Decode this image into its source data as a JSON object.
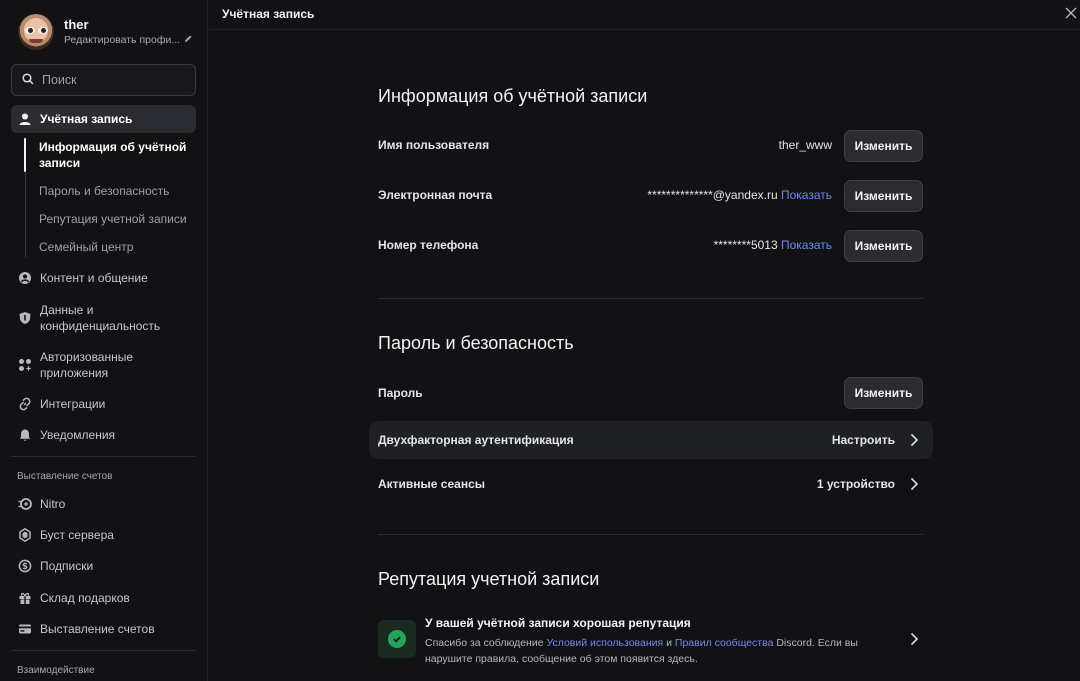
{
  "colors": {
    "background": "#121214",
    "accent_link": "#6d8cf2",
    "success": "#23a55a"
  },
  "profile": {
    "username": "ther",
    "edit_label": "Редактировать профи..."
  },
  "search": {
    "placeholder": "Поиск"
  },
  "sidebar": {
    "items": [
      {
        "label": "Учётная запись",
        "icon": "person-icon",
        "active": true
      },
      {
        "label": "Контент и общение",
        "icon": "emoji-icon"
      },
      {
        "label": "Данные и конфиденциальность",
        "icon": "shield-icon"
      },
      {
        "label": "Авторизованные приложения",
        "icon": "apps-icon"
      },
      {
        "label": "Интеграции",
        "icon": "link-icon"
      },
      {
        "label": "Уведомления",
        "icon": "bell-icon"
      }
    ],
    "subitems": [
      {
        "label": "Информация об учётной записи",
        "active": true
      },
      {
        "label": "Пароль и безопасность"
      },
      {
        "label": "Репутация учетной записи"
      },
      {
        "label": "Семейный центр"
      }
    ],
    "billing_header": "Выставление счетов",
    "billing_items": [
      {
        "label": "Nitro",
        "icon": "nitro-icon"
      },
      {
        "label": "Буст сервера",
        "icon": "boost-icon"
      },
      {
        "label": "Подписки",
        "icon": "subscriptions-icon"
      },
      {
        "label": "Склад подарков",
        "icon": "gift-icon"
      },
      {
        "label": "Выставление счетов",
        "icon": "card-icon"
      }
    ],
    "interaction_header": "Взаимодействие"
  },
  "topbar": {
    "title": "Учётная запись"
  },
  "account_info": {
    "title": "Информация об учётной записи",
    "username_label": "Имя пользователя",
    "username_value": "ther_www",
    "email_label": "Электронная почта",
    "email_value": "**************@yandex.ru",
    "phone_label": "Номер телефона",
    "phone_value": "********5013",
    "show_label": "Показать",
    "change_label": "Изменить"
  },
  "security": {
    "title": "Пароль и безопасность",
    "password_label": "Пароль",
    "twofa_label": "Двухфакторная аутентификация",
    "twofa_action": "Настроить",
    "sessions_label": "Активные сеансы",
    "sessions_value": "1 устройство"
  },
  "reputation": {
    "title": "Репутация учетной записи",
    "status_title": "У вашей учётной записи хорошая репутация",
    "desc_part1": "Спасибо за соблюдение ",
    "terms_link": "Условий использования",
    "desc_and": " и ",
    "guidelines_link": "Правил сообщества",
    "desc_part2": " Discord. Если вы нарушите правила, сообщение об этом появится здесь."
  }
}
